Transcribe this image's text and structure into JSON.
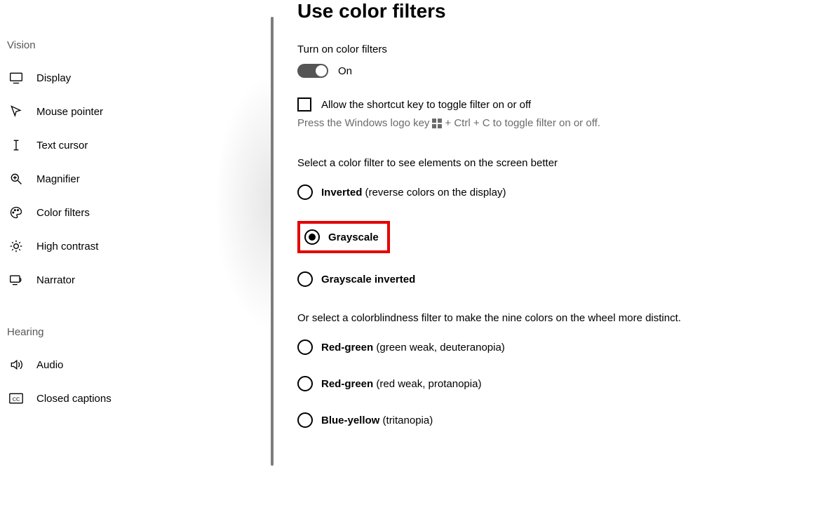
{
  "sidebar": {
    "groups": [
      {
        "title": "Vision",
        "items": [
          {
            "label": "Display"
          },
          {
            "label": "Mouse pointer"
          },
          {
            "label": "Text cursor"
          },
          {
            "label": "Magnifier"
          },
          {
            "label": "Color filters"
          },
          {
            "label": "High contrast"
          },
          {
            "label": "Narrator"
          }
        ]
      },
      {
        "title": "Hearing",
        "items": [
          {
            "label": "Audio"
          },
          {
            "label": "Closed captions"
          }
        ]
      }
    ]
  },
  "main": {
    "title": "Use color filters",
    "toggleTitle": "Turn on color filters",
    "toggleState": "On",
    "checkboxLabel": "Allow the shortcut key to toggle filter on or off",
    "hintA": "Press the Windows logo key",
    "hintB": "+ Ctrl + C to toggle filter on or off.",
    "selectFilterLabel": "Select a color filter to see elements on the screen better",
    "filters": {
      "inverted": {
        "name": "Inverted",
        "extra": " (reverse colors on the display)"
      },
      "grayscale": {
        "name": "Grayscale",
        "extra": ""
      },
      "grayscaleInv": {
        "name": "Grayscale inverted",
        "extra": ""
      }
    },
    "cbLabel": "Or select a colorblindness filter to make the nine colors on the wheel more distinct.",
    "cbFilters": {
      "rg1": {
        "name": "Red-green",
        "extra": " (green weak, deuteranopia)"
      },
      "rg2": {
        "name": "Red-green",
        "extra": " (red weak, protanopia)"
      },
      "by": {
        "name": "Blue-yellow",
        "extra": " (tritanopia)"
      }
    }
  }
}
